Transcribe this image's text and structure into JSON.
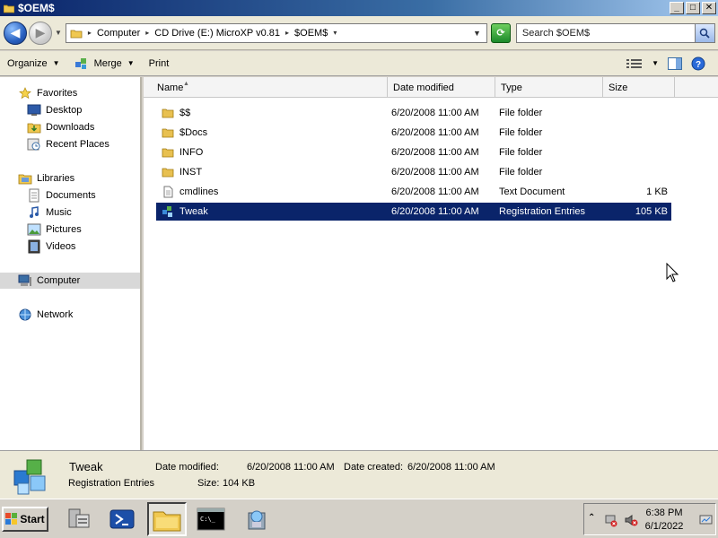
{
  "window": {
    "title": "$OEM$",
    "buttons": {
      "minimize": "_",
      "maximize": "□",
      "close": "✕"
    }
  },
  "address": {
    "crumbs": [
      "Computer",
      "CD Drive (E:) MicroXP v0.81",
      "$OEM$"
    ],
    "search_placeholder": "Search $OEM$"
  },
  "toolbar": {
    "organize": "Organize",
    "merge": "Merge",
    "print": "Print"
  },
  "nav": {
    "favorites": "Favorites",
    "desktop": "Desktop",
    "downloads": "Downloads",
    "recent_places": "Recent Places",
    "libraries": "Libraries",
    "documents": "Documents",
    "music": "Music",
    "pictures": "Pictures",
    "videos": "Videos",
    "computer": "Computer",
    "network": "Network"
  },
  "columns": {
    "name": "Name",
    "date": "Date modified",
    "type": "Type",
    "size": "Size"
  },
  "files": [
    {
      "name": "$$",
      "date": "6/20/2008 11:00 AM",
      "type": "File folder",
      "size": "",
      "icon": "folder-icon"
    },
    {
      "name": "$Docs",
      "date": "6/20/2008 11:00 AM",
      "type": "File folder",
      "size": "",
      "icon": "folder-icon"
    },
    {
      "name": "INFO",
      "date": "6/20/2008 11:00 AM",
      "type": "File folder",
      "size": "",
      "icon": "folder-icon"
    },
    {
      "name": "INST",
      "date": "6/20/2008 11:00 AM",
      "type": "File folder",
      "size": "",
      "icon": "folder-icon"
    },
    {
      "name": "cmdlines",
      "date": "6/20/2008 11:00 AM",
      "type": "Text Document",
      "size": "1 KB",
      "icon": "text-file-icon"
    },
    {
      "name": "Tweak",
      "date": "6/20/2008 11:00 AM",
      "type": "Registration Entries",
      "size": "105 KB",
      "icon": "registry-file-icon",
      "selected": true
    }
  ],
  "details": {
    "name": "Tweak",
    "type": "Registration Entries",
    "modified_label": "Date modified:",
    "modified_value": "6/20/2008 11:00 AM",
    "created_label": "Date created:",
    "created_value": "6/20/2008 11:00 AM",
    "size_label": "Size:",
    "size_value": "104 KB"
  },
  "taskbar": {
    "start": "Start",
    "time": "6:38 PM",
    "date": "6/1/2022"
  },
  "colors": {
    "selection": "#0a246a",
    "title_start": "#0a246a",
    "title_end": "#a6caf0"
  }
}
